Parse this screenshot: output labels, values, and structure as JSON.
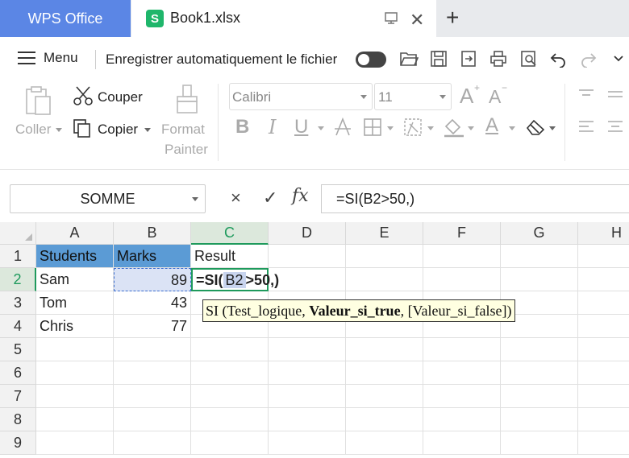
{
  "tabs": {
    "app_tab": "WPS Office",
    "doc_tab": "Book1.xlsx",
    "doc_icon_letter": "S",
    "new_tab": "+"
  },
  "quickbar": {
    "menu_label": "Menu",
    "autosave_label": "Enregistrer automatiquement le fichier",
    "autosave_on": false
  },
  "ribbon": {
    "paste_label": "Coller",
    "cut_label": "Couper",
    "copy_label": "Copier",
    "format_painter_line1": "Format",
    "format_painter_line2": "Painter",
    "font_name": "Calibri",
    "font_size": "11",
    "bold_glyph": "B",
    "italic_glyph": "I",
    "underline_glyph": "U",
    "font_color_glyph": "A",
    "grow_glyph": "A",
    "shrink_glyph": "A"
  },
  "formula_bar": {
    "name_box": "SOMME",
    "cancel_glyph": "×",
    "accept_glyph": "✓",
    "fx_label": "fx",
    "formula": "=SI(B2>50,)"
  },
  "sheet": {
    "columns": [
      "A",
      "B",
      "C",
      "D",
      "E",
      "F",
      "G",
      "H"
    ],
    "rows": [
      "1",
      "2",
      "3",
      "4",
      "5",
      "6",
      "7",
      "8",
      "9"
    ],
    "selected_column": "C",
    "selected_row": "2",
    "cells": {
      "A1": "Students",
      "B1": "Marks",
      "C1": "Result",
      "A2": "Sam",
      "B2": "89",
      "A3": "Tom",
      "B3": "43",
      "A4": "Chris",
      "B4": "77"
    },
    "edit_cell": {
      "prefix": "=SI(",
      "ref": "B2",
      "suffix": ">50,)"
    },
    "tooltip": {
      "fn": "SI (",
      "arg1": "Test_logique, ",
      "arg2": "Valeur_si_true",
      "arg3": ", [Valeur_si_false])"
    }
  },
  "colors": {
    "accent_blue": "#5b86e5",
    "excel_green": "#1e9a5c",
    "header_fill": "#5b9bd5",
    "tooltip_bg": "#ffffe1"
  }
}
